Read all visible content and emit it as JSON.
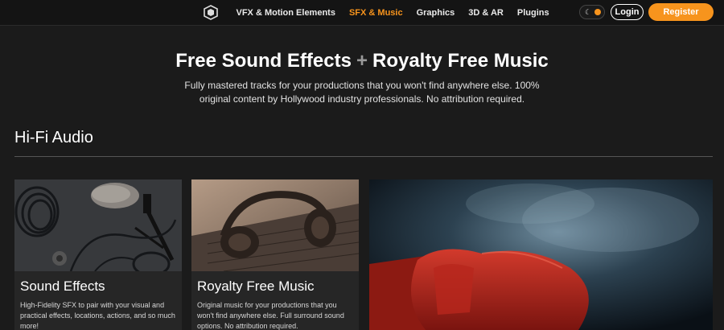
{
  "nav": {
    "items": [
      {
        "label": "VFX & Motion Elements",
        "active": false
      },
      {
        "label": "SFX & Music",
        "active": true
      },
      {
        "label": "Graphics",
        "active": false
      },
      {
        "label": "3D & AR",
        "active": false
      },
      {
        "label": "Plugins",
        "active": false
      }
    ],
    "login_label": "Login",
    "register_label": "Register",
    "accent_color": "#f7941d",
    "theme_icons": [
      "moon-icon",
      "sun-icon"
    ]
  },
  "hero": {
    "title_left": "Free Sound Effects",
    "title_plus": "+",
    "title_right": "Royalty Free Music",
    "subtitle": "Fully mastered tracks for your productions that you won't find anywhere else. 100% original content by Hollywood industry professionals. No attribution required."
  },
  "section": {
    "title": "Hi-Fi Audio"
  },
  "cards": [
    {
      "title": "Sound Effects",
      "description": "High-Fidelity SFX to pair with your visual and practical effects, locations, actions, and so much more!"
    },
    {
      "title": "Royalty Free Music",
      "description": "Original music for your productions that you won't find anywhere else. Full surround sound options. No attribution required."
    }
  ]
}
